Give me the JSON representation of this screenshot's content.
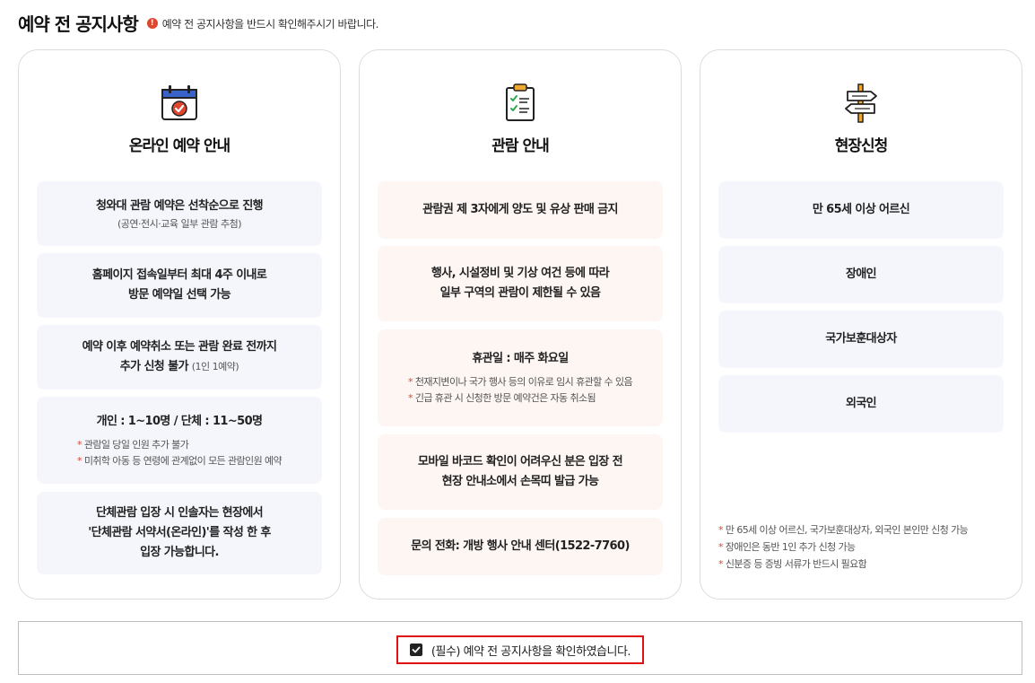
{
  "header": {
    "title": "예약 전 공지사항",
    "notice": "예약 전 공지사항을 반드시 확인해주시기 바랍니다."
  },
  "online": {
    "title": "온라인 예약 안내",
    "box1": {
      "main": "청와대 관람 예약은 선착순으로 진행",
      "sub": "(공연·전시·교육 일부 관람 추첨)"
    },
    "box2": {
      "line1": "홈페이지 접속일부터 최대 4주 이내로",
      "line2": "방문 예약일 선택 가능"
    },
    "box3": {
      "line1": "예약 이후 예약취소 또는 관람 완료 전까지",
      "line2": "추가 신청 불가",
      "line2_sub": "(1인 1예약)"
    },
    "box4": {
      "main": "개인 : 1~10명 / 단체 : 11~50명",
      "notes": [
        "관람일 당일 인원 추가 불가",
        "미취학 아동 등 연령에 관계없이 모든 관람인원 예약"
      ]
    },
    "box5": {
      "line1": "단체관람 입장 시 인솔자는 현장에서",
      "line2": "'단체관람 서약서(온라인)'를 작성 한 후",
      "line3": "입장 가능합니다."
    }
  },
  "viewing": {
    "title": "관람 안내",
    "box1": "관람권 제 3자에게 양도 및 유상 판매 금지",
    "box2": {
      "line1": "행사, 시설정비 및 기상 여건 등에 따라",
      "line2": "일부 구역의 관람이 제한될 수 있음"
    },
    "box3": {
      "main": "휴관일 : 매주 화요일",
      "notes": [
        "천재지변이나 국가 행사 등의 이유로 임시 휴관할 수 있음",
        "긴급 휴관 시 신청한 방문 예약건은 자동 취소됨"
      ]
    },
    "box4": {
      "line1": "모바일 바코드 확인이 어려우신 분은 입장 전",
      "line2": "현장 안내소에서 손목띠 발급 가능"
    },
    "box5": "문의 전화: 개방 행사 안내 센터(1522-7760)"
  },
  "onsite": {
    "title": "현장신청",
    "items": [
      "만 65세 이상 어르신",
      "장애인",
      "국가보훈대상자",
      "외국인"
    ],
    "notes": [
      "만 65세 이상 어르신, 국가보훈대상자, 외국인 본인만 신청 가능",
      "장애인은 동반 1인 추가 신청 가능",
      "신분증 등 증빙 서류가 반드시 필요함"
    ]
  },
  "confirm": {
    "label": "(필수) 예약 전 공지사항을 확인하였습니다.",
    "checked": true
  },
  "icons": {
    "notice": "info-icon",
    "online": "calendar-check-icon",
    "viewing": "clipboard-checklist-icon",
    "onsite": "signpost-icon",
    "confirm": "checkmark-icon"
  },
  "colors": {
    "accent_red": "#e0462d",
    "highlight_red": "#e01010",
    "box_blue": "#f4f6fb",
    "box_peach": "#fdf6f3"
  }
}
